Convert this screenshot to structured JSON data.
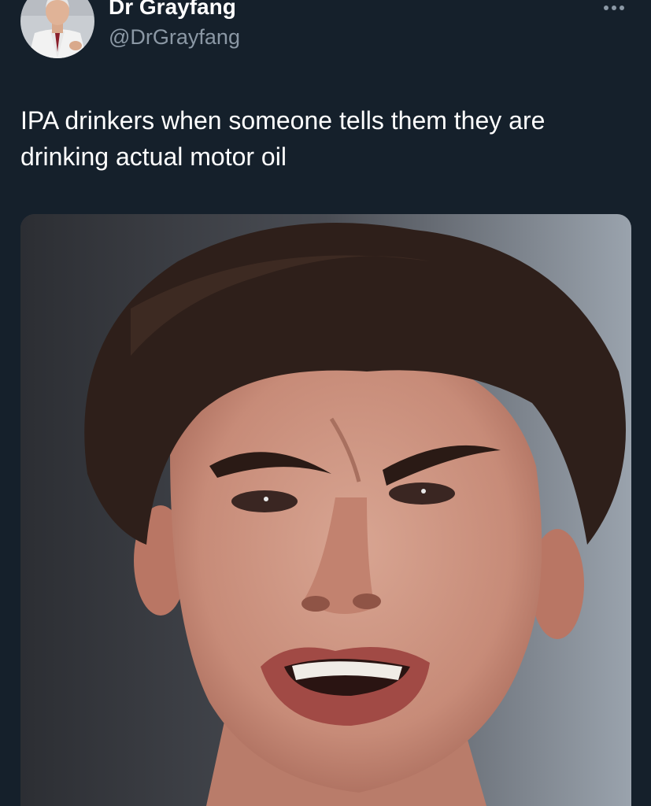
{
  "tweet": {
    "author": {
      "display_name": "Dr Grayfang",
      "handle": "@DrGrayfang",
      "avatar_icon": "avatar-photo"
    },
    "more_icon": "more-options-icon",
    "text": "IPA drinkers when someone tells them they are drinking actual motor oil",
    "media_icon": "meme-photo"
  },
  "colors": {
    "background": "#15202b",
    "primary_text": "#ffffff",
    "secondary_text": "#8b98a5"
  }
}
